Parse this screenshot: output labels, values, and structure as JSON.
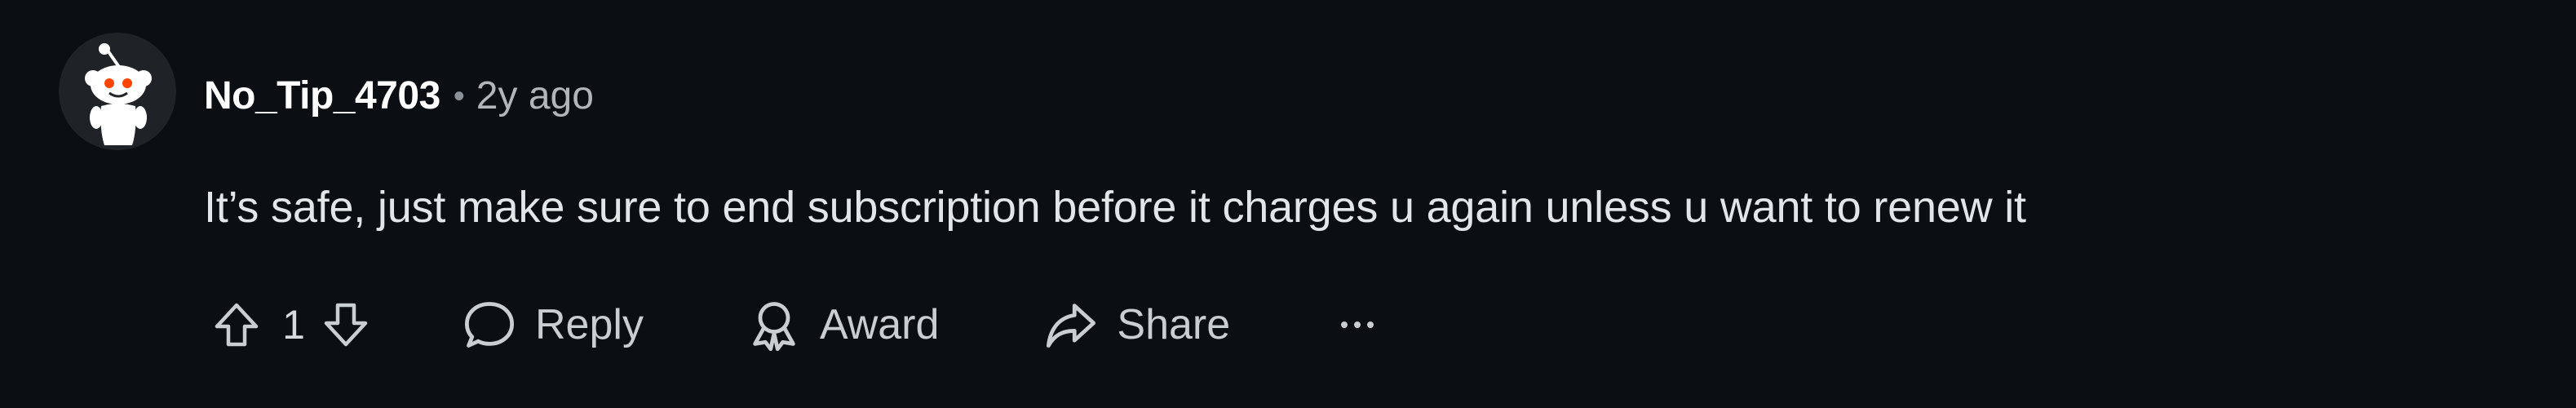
{
  "comment": {
    "author": "No_Tip_4703",
    "separator": "•",
    "timestamp": "2y ago",
    "body": "It’s safe, just make sure to end subscription before it charges u again unless u want to renew it",
    "vote_count": "1"
  },
  "actions": {
    "reply_label": "Reply",
    "award_label": "Award",
    "share_label": "Share"
  },
  "icons": {
    "avatar": "snoo-avatar-icon",
    "upvote": "upvote-arrow-icon",
    "downvote": "downvote-arrow-icon",
    "reply": "speech-bubble-icon",
    "award": "award-ribbon-icon",
    "share": "share-arrow-icon",
    "more": "ellipsis-icon"
  },
  "colors": {
    "background": "#0b0e12",
    "username": "#ffffff",
    "text": "#e3e6e8",
    "muted": "#b0b6ba",
    "avatar_accent": "#ff4500"
  }
}
